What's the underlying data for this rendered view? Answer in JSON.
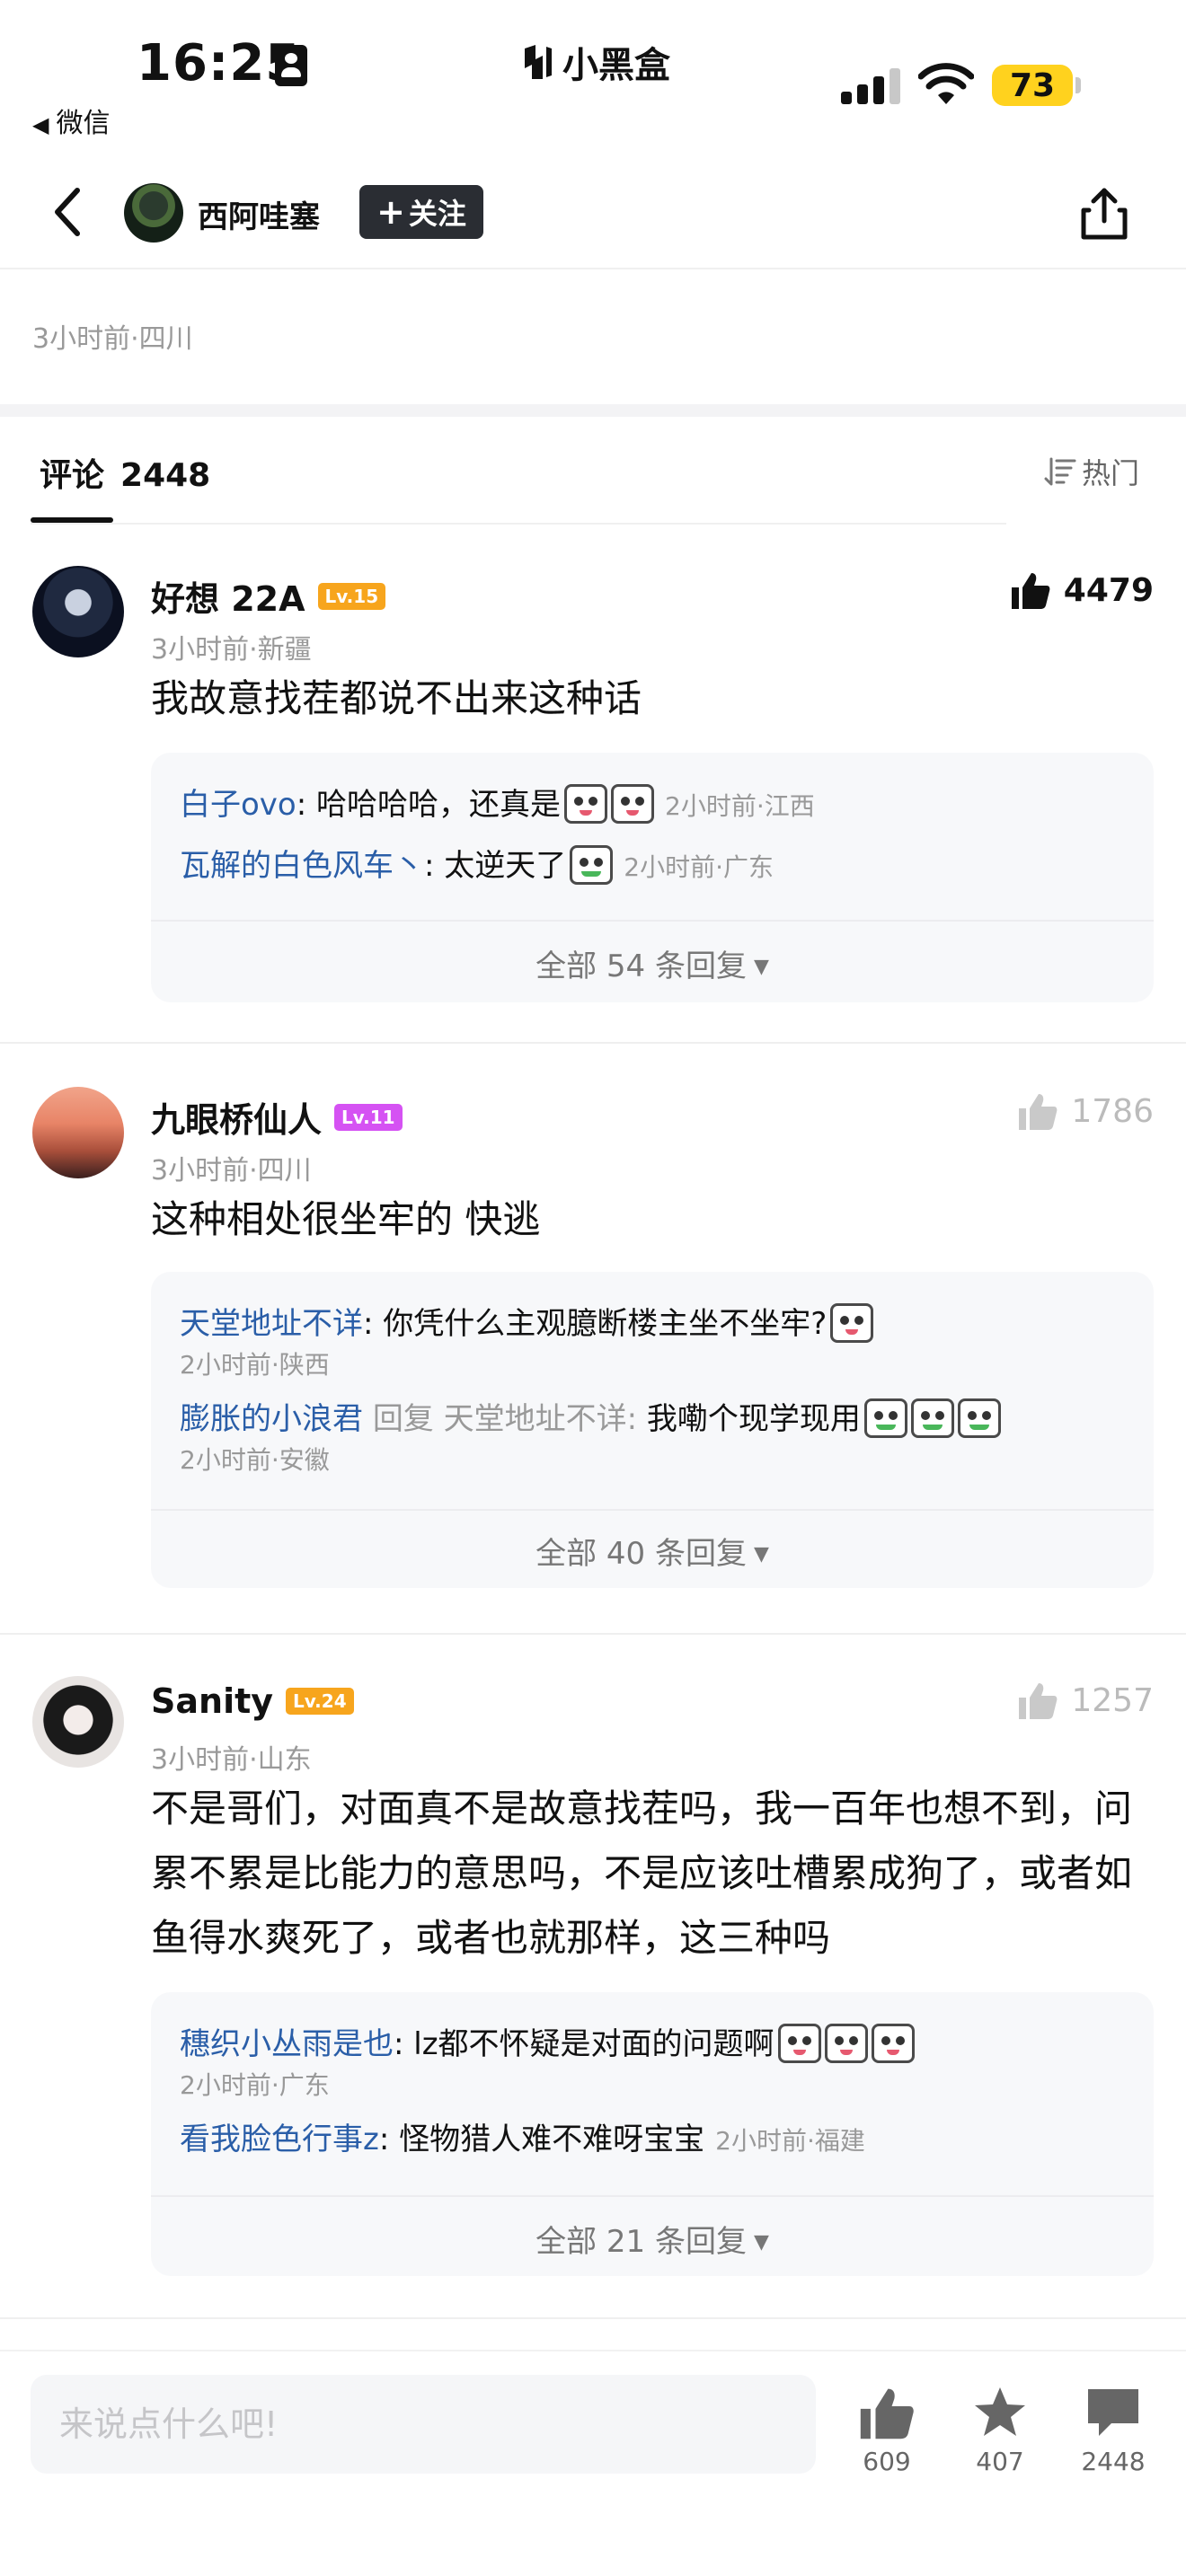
{
  "status_bar": {
    "time": "16:25",
    "back_app": "微信",
    "app_name": "小黑盒",
    "battery": "73"
  },
  "nav": {
    "author": "西阿哇塞",
    "follow_label": "关注"
  },
  "post": {
    "meta": "3小时前·四川"
  },
  "comments_header": {
    "tab_label": "评论",
    "count": "2448",
    "sort_label": "热门"
  },
  "comments": [
    {
      "user": "好想 22A",
      "level": "Lv.15",
      "time": "3小时前·新疆",
      "text": "我故意找茬都说不出来这种话",
      "likes": "4479",
      "replies": [
        {
          "user": "白子ovo",
          "text": "哈哈哈哈，还真是",
          "meta": "2小时前·江西"
        },
        {
          "user": "瓦解的白色风车丶",
          "text": "太逆天了",
          "meta": "2小时前·广东"
        }
      ],
      "more": "全部 54 条回复"
    },
    {
      "user": "九眼桥仙人",
      "level": "Lv.11",
      "time": "3小时前·四川",
      "text": "这种相处很坐牢的 快逃",
      "likes": "1786",
      "replies": [
        {
          "user": "天堂地址不详",
          "text": "你凭什么主观臆断楼主坐不坐牢?",
          "meta": "2小时前·陕西"
        },
        {
          "user": "膨胀的小浪君",
          "reply_word": "回复",
          "reply_to": "天堂地址不详",
          "text": "我嘞个现学现用",
          "meta": "2小时前·安徽"
        }
      ],
      "more": "全部 40 条回复"
    },
    {
      "user": "Sanity",
      "level": "Lv.24",
      "time": "3小时前·山东",
      "text": "不是哥们，对面真不是故意找茬吗，我一百年也想不到，问累不累是比能力的意思吗，不是应该吐槽累成狗了，或者如鱼得水爽死了，或者也就那样，这三种吗",
      "likes": "1257",
      "replies": [
        {
          "user": "穗织小丛雨是也",
          "text": "lz都不怀疑是对面的问题啊",
          "meta": "2小时前·广东"
        },
        {
          "user": "看我脸色行事z",
          "text": "怪物猎人难不难呀宝宝",
          "meta": "2小时前·福建"
        }
      ],
      "more": "全部 21 条回复"
    }
  ],
  "bottom_bar": {
    "input_placeholder": "来说点什么吧!",
    "like_count": "609",
    "fav_count": "407",
    "comment_count": "2448"
  },
  "colors": {
    "reply_name": "#2a5ea8",
    "level_orange": "#f7a51d",
    "level_purple": "#d552f3",
    "battery": "#ffd21e"
  }
}
